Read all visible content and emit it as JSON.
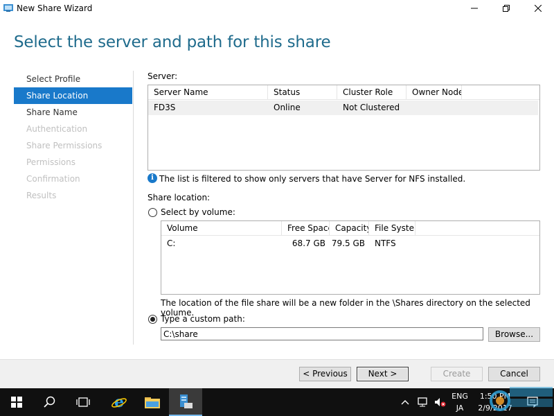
{
  "window": {
    "title": "New Share Wizard"
  },
  "page": {
    "title": "Select the server and path for this share"
  },
  "nav": {
    "items": [
      {
        "label": "Select Profile",
        "state": "normal"
      },
      {
        "label": "Share Location",
        "state": "active"
      },
      {
        "label": "Share Name",
        "state": "normal"
      },
      {
        "label": "Authentication",
        "state": "disabled"
      },
      {
        "label": "Share Permissions",
        "state": "disabled"
      },
      {
        "label": "Permissions",
        "state": "disabled"
      },
      {
        "label": "Confirmation",
        "state": "disabled"
      },
      {
        "label": "Results",
        "state": "disabled"
      }
    ]
  },
  "server": {
    "label": "Server:",
    "columns": [
      "Server Name",
      "Status",
      "Cluster Role",
      "Owner Node"
    ],
    "rows": [
      {
        "name": "FD3S",
        "status": "Online",
        "cluster_role": "Not Clustered",
        "owner_node": ""
      }
    ],
    "info": "The list is filtered to show only servers that have Server for NFS installed."
  },
  "share_location": {
    "label": "Share location:",
    "by_volume_label": "Select by volume:",
    "volume_columns": [
      "Volume",
      "Free Space",
      "Capacity",
      "File System"
    ],
    "volumes": [
      {
        "volume": "C:",
        "free_space": "68.7 GB",
        "capacity": "79.5 GB",
        "file_system": "NTFS"
      }
    ],
    "volume_note": "The location of the file share will be a new folder in the \\Shares directory on the selected volume.",
    "custom_path_label": "Type a custom path:",
    "custom_path_value": "C:\\share",
    "selected_option": "custom"
  },
  "buttons": {
    "browse": "Browse...",
    "previous": "< Previous",
    "next": "Next >",
    "create": "Create",
    "cancel": "Cancel"
  },
  "taskbar": {
    "lang_top": "ENG",
    "lang_bottom": "JA",
    "time": "1:50 PM",
    "date": "2/9/2017"
  },
  "colors": {
    "title_blue": "#1f6b8c",
    "nav_active": "#1979ca",
    "taskbar": "#101010"
  }
}
